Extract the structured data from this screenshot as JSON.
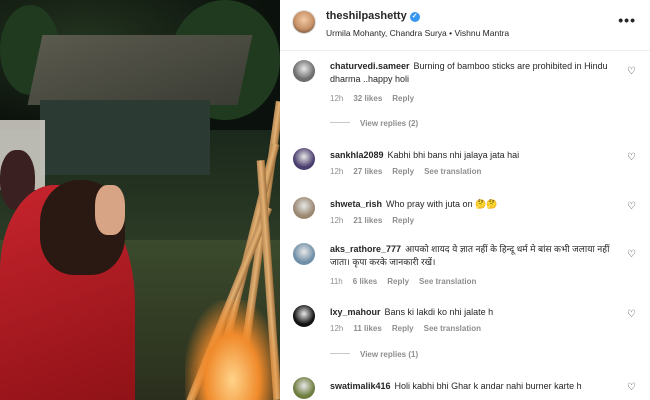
{
  "post": {
    "username": "theshilpashetty",
    "verified_mark": "✓",
    "subtitle": "Urmila Mohanty, Chandra Surya • Vishnu Mantra",
    "more": "•••"
  },
  "labels": {
    "reply": "Reply",
    "see_translation": "See translation"
  },
  "comments": [
    {
      "user": "chaturvedi.sameer",
      "text": "Burning of bamboo sticks are prohibited in Hindu dharma ..happy holi",
      "time": "12h",
      "likes": "32 likes",
      "translation": false,
      "replies": "View replies (2)",
      "avatar_color": "#6d6d6d"
    },
    {
      "user": "sankhla2089",
      "text": "Kabhi bhi bans nhi jalaya jata hai",
      "time": "12h",
      "likes": "27 likes",
      "translation": true,
      "avatar_color": "#4a3e6e"
    },
    {
      "user": "shweta_rish",
      "text": "Who pray with juta on 🤔🤔",
      "time": "12h",
      "likes": "21 likes",
      "translation": false,
      "avatar_color": "#9a8770"
    },
    {
      "user": "aks_rathore_777",
      "text": "आपको शायद ये ज्ञात नहीं के हिन्दू धर्म मे बांस कभी जलाया नहीं जाता। कृपा करके जानकारी रखें।",
      "time": "11h",
      "likes": "6 likes",
      "translation": true,
      "avatar_color": "#6f8fa8"
    },
    {
      "user": "lxy_mahour",
      "text": "Bans ki lakdi ko nhi jalate h",
      "time": "12h",
      "likes": "11 likes",
      "translation": true,
      "replies": "View replies (1)",
      "avatar_color": "#111111"
    },
    {
      "user": "swatimalik416",
      "text": "Holi kabhi bhi Ghar k andar nahi burner karte h",
      "avatar_color": "#6e7d3e"
    }
  ]
}
